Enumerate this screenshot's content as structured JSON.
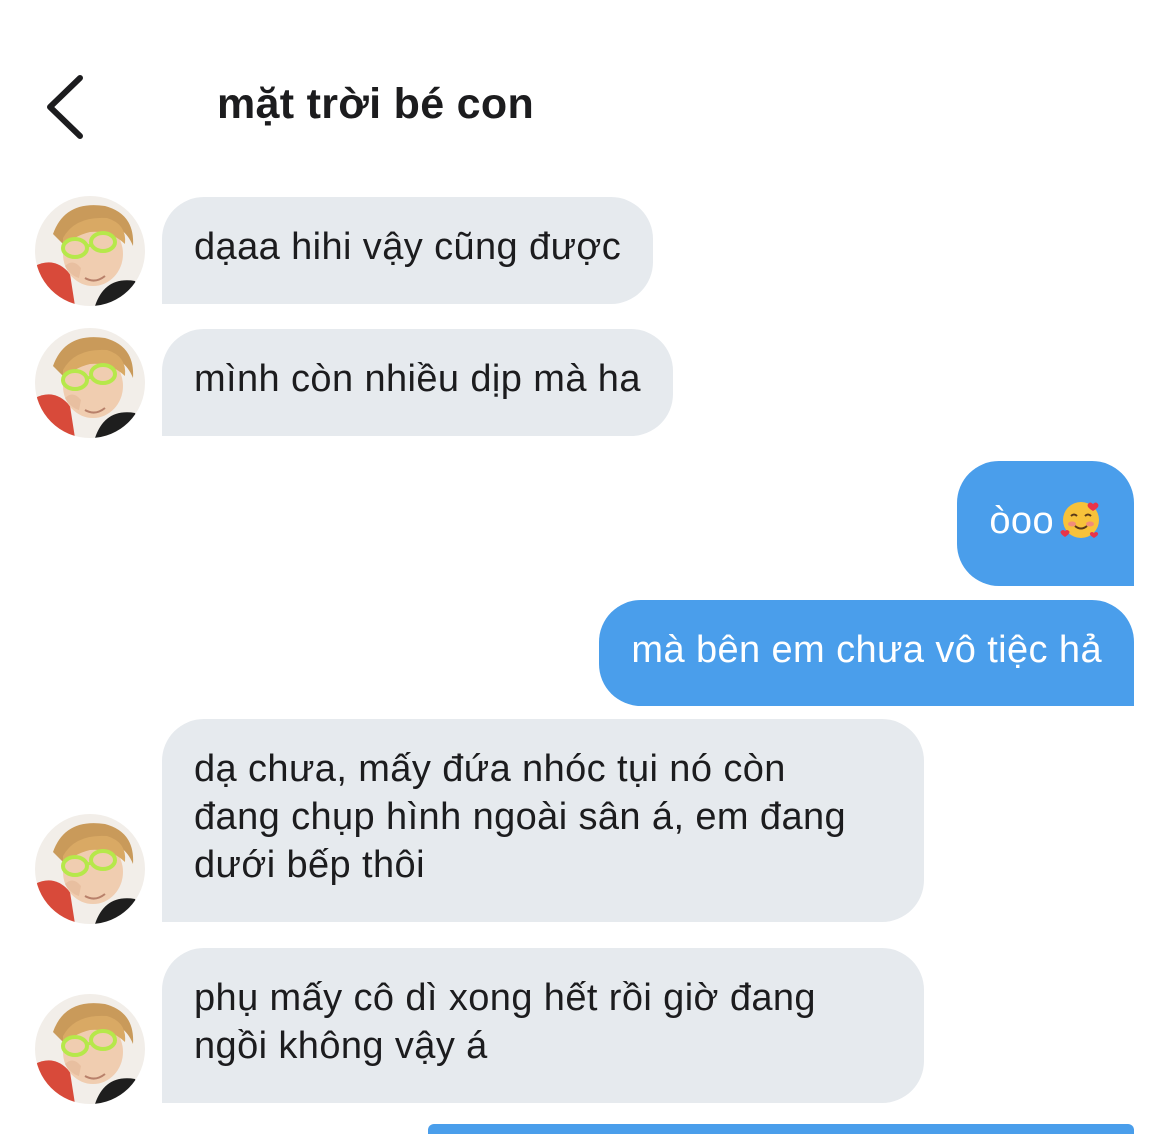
{
  "header": {
    "back_icon": "chevron-left-icon",
    "title": "mặt trời bé con"
  },
  "contact": {
    "avatar_icon": "person-with-sunglasses-avatar"
  },
  "messages": [
    {
      "direction": "incoming",
      "lines": [
        "dạaa hihi vậy cũng được"
      ]
    },
    {
      "direction": "incoming",
      "lines": [
        "mình còn nhiều dịp mà ha"
      ]
    },
    {
      "direction": "outgoing",
      "lines": [
        "òoo"
      ],
      "emoji": "smiling-face-with-hearts-icon"
    },
    {
      "direction": "outgoing",
      "lines": [
        "mà bên em chưa vô tiệc hả"
      ]
    },
    {
      "direction": "incoming",
      "lines": [
        "dạ chưa, mấy đứa nhóc tụi nó còn",
        "đang chụp hình ngoài sân á, em đang",
        "dưới bếp thôi"
      ]
    },
    {
      "direction": "incoming",
      "lines": [
        "phụ mấy cô dì xong hết rồi giờ đang",
        "ngồi không vậy á"
      ]
    }
  ],
  "colors": {
    "incoming_bubble": "#e6eaee",
    "outgoing_bubble": "#4a9eeb",
    "text_dark": "#1c1c1e",
    "text_light": "#ffffff"
  }
}
